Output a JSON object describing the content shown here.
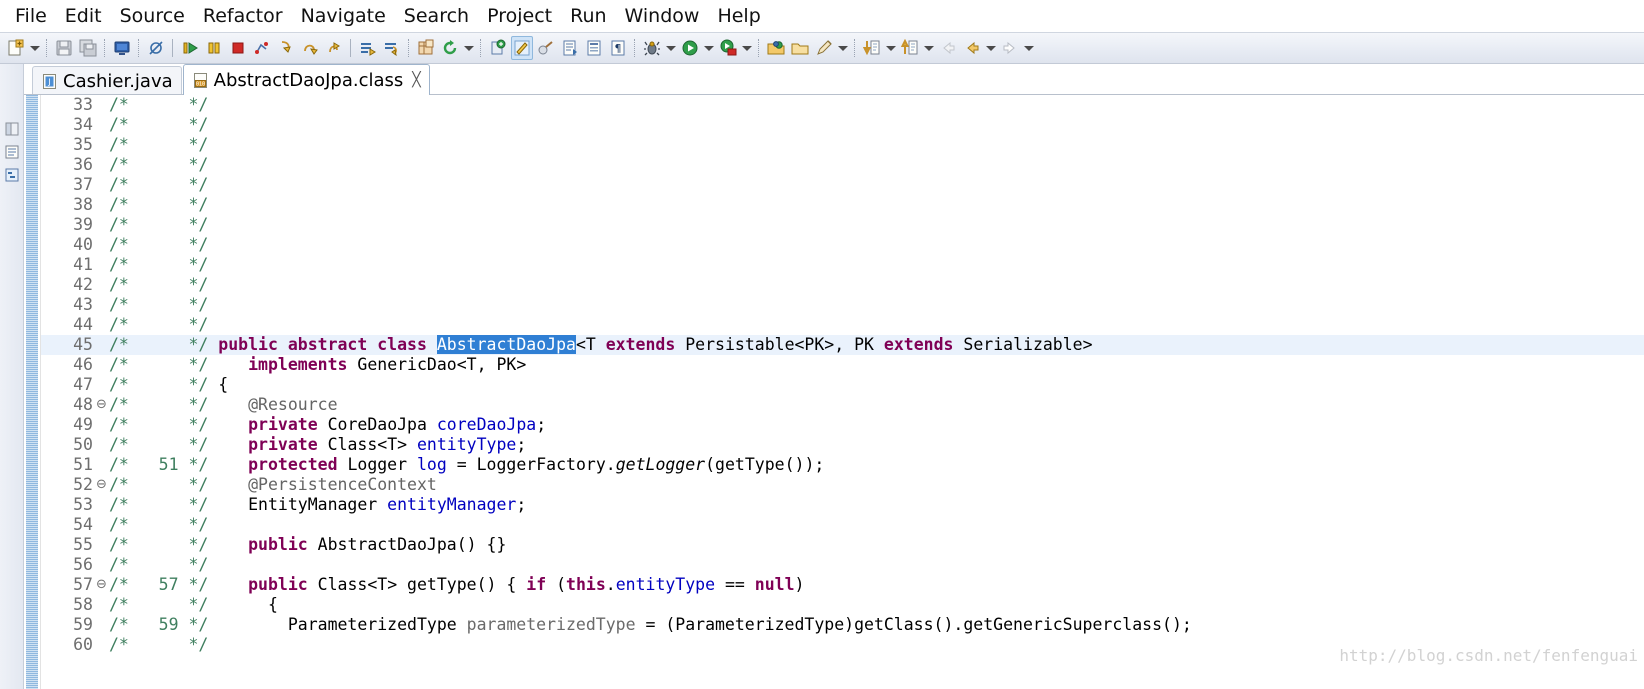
{
  "window": {
    "app": "Eclipse IDE"
  },
  "menubar": {
    "items": [
      {
        "label": "File",
        "name": "menu-file"
      },
      {
        "label": "Edit",
        "name": "menu-edit"
      },
      {
        "label": "Source",
        "name": "menu-source"
      },
      {
        "label": "Refactor",
        "name": "menu-refactor"
      },
      {
        "label": "Navigate",
        "name": "menu-navigate"
      },
      {
        "label": "Search",
        "name": "menu-search"
      },
      {
        "label": "Project",
        "name": "menu-project"
      },
      {
        "label": "Run",
        "name": "menu-run"
      },
      {
        "label": "Window",
        "name": "menu-window"
      },
      {
        "label": "Help",
        "name": "menu-help"
      }
    ]
  },
  "toolbar": {
    "icons": [
      "new-wizard-icon",
      "dropdown-arrow",
      "save-icon",
      "save-all-icon",
      "sep",
      "new-console-icon",
      "sep",
      "skip-breakpoints-icon",
      "sep-solid",
      "resume-icon",
      "suspend-icon",
      "terminate-icon",
      "disconnect-icon",
      "step-into-icon",
      "step-over-icon",
      "step-return-icon",
      "sep-solid",
      "instruction-stepping-icon",
      "drop-to-frame-icon",
      "sep",
      "new-java-project-icon",
      "refresh-icon",
      "dropdown-arrow",
      "sep",
      "open-type-icon",
      "java-perspective-icon",
      "external-tools-icon",
      "search-icon",
      "open-task-icon",
      "toggle-mark-occurrences-icon",
      "sep",
      "debug-icon",
      "dropdown-arrow",
      "run-icon",
      "dropdown-arrow",
      "run-last-tool-icon",
      "dropdown-arrow",
      "sep",
      "open-folder-icon",
      "open-package-icon",
      "pencil-icon",
      "dropdown-arrow",
      "sep",
      "next-annotation-icon",
      "dropdown-arrow",
      "previous-annotation-icon",
      "dropdown-arrow",
      "back-disabled-icon",
      "back-icon",
      "dropdown-arrow",
      "forward-icon",
      "dropdown-arrow"
    ]
  },
  "editor": {
    "tabs": [
      {
        "label": "Cashier.java",
        "icon": "java-file-icon",
        "active": false,
        "closable": false
      },
      {
        "label": "AbstractDaoJpa.class",
        "icon": "class-file-icon",
        "active": true,
        "closable": true,
        "close_glyph": "╳"
      }
    ],
    "selected_token": "AbstractDaoJpa",
    "watermark": "http://blog.csdn.net/fenfenguai",
    "lines": [
      {
        "num": "33",
        "fold": "",
        "hl": false,
        "src_num": "",
        "segs": []
      },
      {
        "num": "34",
        "fold": "",
        "hl": false,
        "src_num": "",
        "segs": []
      },
      {
        "num": "35",
        "fold": "",
        "hl": false,
        "src_num": "",
        "segs": []
      },
      {
        "num": "36",
        "fold": "",
        "hl": false,
        "src_num": "",
        "segs": []
      },
      {
        "num": "37",
        "fold": "",
        "hl": false,
        "src_num": "",
        "segs": []
      },
      {
        "num": "38",
        "fold": "",
        "hl": false,
        "src_num": "",
        "segs": []
      },
      {
        "num": "39",
        "fold": "",
        "hl": false,
        "src_num": "",
        "segs": []
      },
      {
        "num": "40",
        "fold": "",
        "hl": false,
        "src_num": "",
        "segs": []
      },
      {
        "num": "41",
        "fold": "",
        "hl": false,
        "src_num": "",
        "segs": []
      },
      {
        "num": "42",
        "fold": "",
        "hl": false,
        "src_num": "",
        "segs": []
      },
      {
        "num": "43",
        "fold": "",
        "hl": false,
        "src_num": "",
        "segs": []
      },
      {
        "num": "44",
        "fold": "",
        "hl": false,
        "src_num": "",
        "segs": []
      },
      {
        "num": "45",
        "fold": "",
        "hl": true,
        "src_num": "",
        "segs": [
          {
            "t": " ",
            "c": "plain"
          },
          {
            "t": "public abstract class",
            "c": "kw"
          },
          {
            "t": " ",
            "c": "plain"
          },
          {
            "t": "AbstractDaoJpa",
            "c": "sel"
          },
          {
            "t": "<T ",
            "c": "plain"
          },
          {
            "t": "extends",
            "c": "kw"
          },
          {
            "t": " Persistable<PK>, PK ",
            "c": "plain"
          },
          {
            "t": "extends",
            "c": "kw"
          },
          {
            "t": " Serializable>",
            "c": "plain"
          }
        ]
      },
      {
        "num": "46",
        "fold": "",
        "hl": false,
        "src_num": "",
        "segs": [
          {
            "t": "    ",
            "c": "plain"
          },
          {
            "t": "implements",
            "c": "kw"
          },
          {
            "t": " GenericDao<T, PK>",
            "c": "plain"
          }
        ]
      },
      {
        "num": "47",
        "fold": "",
        "hl": false,
        "src_num": "",
        "segs": [
          {
            "t": " {",
            "c": "plain"
          }
        ]
      },
      {
        "num": "48",
        "fold": "⊖",
        "hl": false,
        "src_num": "",
        "segs": [
          {
            "t": "    ",
            "c": "plain"
          },
          {
            "t": "@Resource",
            "c": "ann"
          }
        ]
      },
      {
        "num": "49",
        "fold": "",
        "hl": false,
        "src_num": "",
        "segs": [
          {
            "t": "    ",
            "c": "plain"
          },
          {
            "t": "private",
            "c": "kw"
          },
          {
            "t": " CoreDaoJpa ",
            "c": "plain"
          },
          {
            "t": "coreDaoJpa",
            "c": "fld"
          },
          {
            "t": ";",
            "c": "plain"
          }
        ]
      },
      {
        "num": "50",
        "fold": "",
        "hl": false,
        "src_num": "",
        "segs": [
          {
            "t": "    ",
            "c": "plain"
          },
          {
            "t": "private",
            "c": "kw"
          },
          {
            "t": " Class<T> ",
            "c": "plain"
          },
          {
            "t": "entityType",
            "c": "fld"
          },
          {
            "t": ";",
            "c": "plain"
          }
        ]
      },
      {
        "num": "51",
        "fold": "",
        "hl": false,
        "src_num": "51",
        "segs": [
          {
            "t": "    ",
            "c": "plain"
          },
          {
            "t": "protected",
            "c": "kw"
          },
          {
            "t": " Logger ",
            "c": "plain"
          },
          {
            "t": "log",
            "c": "fld"
          },
          {
            "t": " = LoggerFactory.",
            "c": "plain"
          },
          {
            "t": "getLogger",
            "c": "stat"
          },
          {
            "t": "(getType());",
            "c": "plain"
          }
        ]
      },
      {
        "num": "52",
        "fold": "⊖",
        "hl": false,
        "src_num": "",
        "segs": [
          {
            "t": "    ",
            "c": "plain"
          },
          {
            "t": "@PersistenceContext",
            "c": "ann"
          }
        ]
      },
      {
        "num": "53",
        "fold": "",
        "hl": false,
        "src_num": "",
        "segs": [
          {
            "t": "    EntityManager ",
            "c": "plain"
          },
          {
            "t": "entityManager",
            "c": "fld"
          },
          {
            "t": ";",
            "c": "plain"
          }
        ]
      },
      {
        "num": "54",
        "fold": "",
        "hl": false,
        "src_num": "",
        "segs": []
      },
      {
        "num": "55",
        "fold": "",
        "hl": false,
        "src_num": "",
        "segs": [
          {
            "t": "    ",
            "c": "plain"
          },
          {
            "t": "public",
            "c": "kw"
          },
          {
            "t": " AbstractDaoJpa() {}",
            "c": "plain"
          }
        ]
      },
      {
        "num": "56",
        "fold": "",
        "hl": false,
        "src_num": "",
        "segs": []
      },
      {
        "num": "57",
        "fold": "⊖",
        "hl": false,
        "src_num": "57",
        "segs": [
          {
            "t": "    ",
            "c": "plain"
          },
          {
            "t": "public",
            "c": "kw"
          },
          {
            "t": " Class<T> getType() { ",
            "c": "plain"
          },
          {
            "t": "if",
            "c": "kw"
          },
          {
            "t": " (",
            "c": "plain"
          },
          {
            "t": "this",
            "c": "kw"
          },
          {
            "t": ".",
            "c": "plain"
          },
          {
            "t": "entityType",
            "c": "fld"
          },
          {
            "t": " == ",
            "c": "plain"
          },
          {
            "t": "null",
            "c": "kw"
          },
          {
            "t": ")",
            "c": "plain"
          }
        ]
      },
      {
        "num": "58",
        "fold": "",
        "hl": false,
        "src_num": "",
        "segs": [
          {
            "t": "      {",
            "c": "plain"
          }
        ]
      },
      {
        "num": "59",
        "fold": "",
        "hl": false,
        "src_num": "59",
        "segs": [
          {
            "t": "        ParameterizedType ",
            "c": "plain"
          },
          {
            "t": "parameterizedType",
            "c": "loc"
          },
          {
            "t": " = (ParameterizedType)getClass().getGenericSuperclass();",
            "c": "plain"
          }
        ]
      },
      {
        "num": "60",
        "fold": "",
        "hl": false,
        "src_num": "",
        "segs": []
      }
    ],
    "comment_open": "/*",
    "comment_close": "*/"
  },
  "colors": {
    "keyword": "#7f0055",
    "comment": "#3f7f5f",
    "field": "#0000c0",
    "annotation": "#646464",
    "selection": "#2f7fd4",
    "current_line": "#eaf2fc"
  }
}
